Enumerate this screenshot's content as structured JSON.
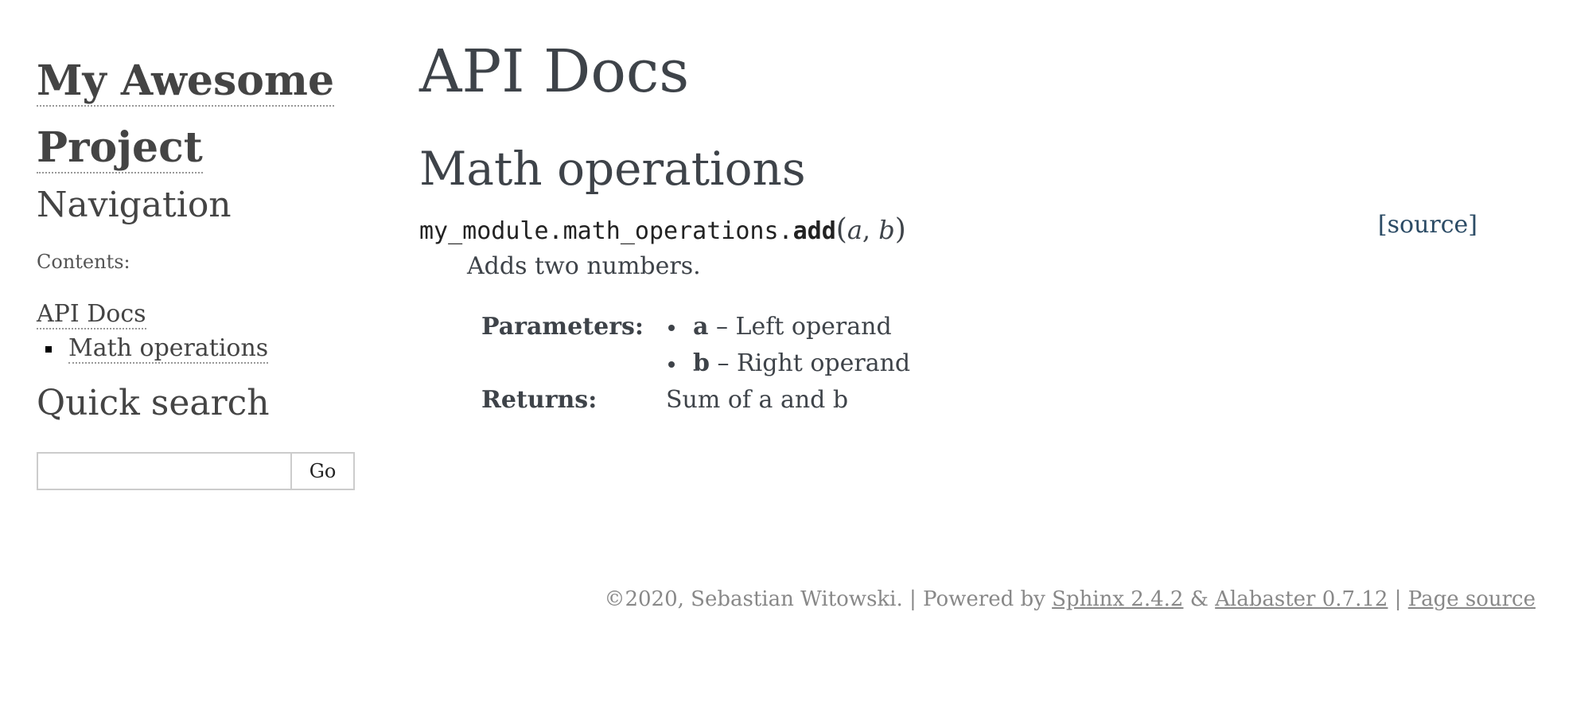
{
  "sidebar": {
    "logo_line1": "My Awesome",
    "logo_line2": "Project",
    "navigation_heading": "Navigation",
    "toc_caption": "Contents:",
    "toc_top_item": "API Docs",
    "toc_sub_items": [
      "Math operations"
    ],
    "quick_search_heading": "Quick search",
    "search": {
      "value": "",
      "button_label": "Go"
    }
  },
  "main": {
    "title": "API Docs",
    "section_title": "Math operations",
    "function": {
      "module_prefix": "my_module.math_operations.",
      "name": "add",
      "open_paren": "(",
      "params_display": [
        "a",
        "b"
      ],
      "separator": ", ",
      "close_paren": ")",
      "source_link": "[source]",
      "description": "Adds two numbers.",
      "fields": {
        "parameters_label": "Parameters:",
        "parameters": [
          {
            "name": "a",
            "dash": " – ",
            "description": "Left operand"
          },
          {
            "name": "b",
            "dash": " – ",
            "description": "Right operand"
          }
        ],
        "returns_label": "Returns:",
        "returns": "Sum of a and b"
      }
    }
  },
  "footer": {
    "copyright": "©2020, Sebastian Witowski.",
    "sep1": " | Powered by ",
    "sphinx_link": "Sphinx 2.4.2",
    "amp": " & ",
    "alabaster_link": "Alabaster 0.7.12",
    "sep2": " | ",
    "page_source_link": "Page source"
  },
  "colors": {
    "text": "#3e4349",
    "heading": "#444444",
    "link_source": "#2b4b65",
    "footer": "#888888",
    "input_border": "#cccccc"
  }
}
